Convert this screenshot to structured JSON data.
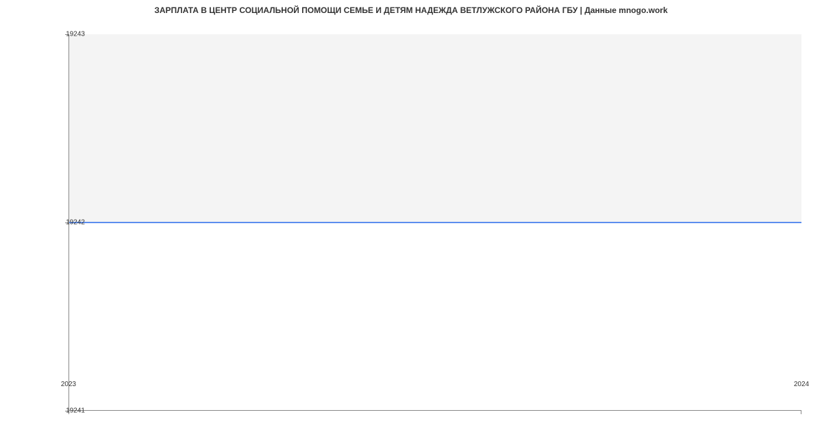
{
  "chart_data": {
    "type": "line",
    "title": "ЗАРПЛАТА В ЦЕНТР СОЦИАЛЬНОЙ ПОМОЩИ СЕМЬЕ И ДЕТЯМ НАДЕЖДА  ВЕТЛУЖСКОГО РАЙОНА ГБУ | Данные mnogo.work",
    "x": [
      2023,
      2024
    ],
    "values": [
      19242,
      19242
    ],
    "xlabel": "",
    "ylabel": "",
    "xlim": [
      2023,
      2024
    ],
    "ylim": [
      19241,
      19243
    ],
    "xticks": [
      2023,
      2024
    ],
    "yticks": [
      19241,
      19242,
      19243
    ],
    "line_color": "#5b8def"
  },
  "labels": {
    "ytick0": "19241",
    "ytick1": "19242",
    "ytick2": "19243",
    "xtick0": "2023",
    "xtick1": "2024"
  }
}
